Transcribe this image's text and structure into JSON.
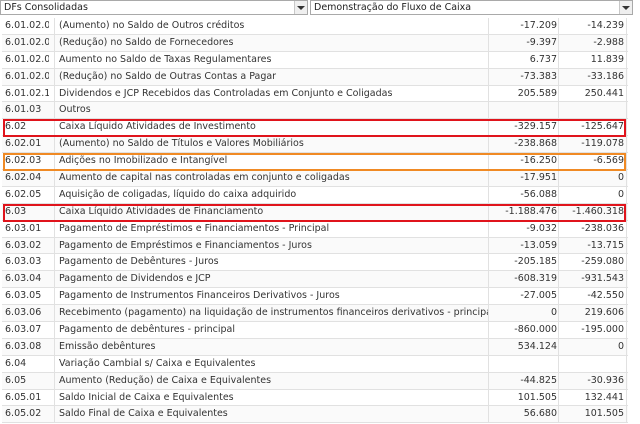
{
  "toolbar": {
    "dfs_select": "DFs Consolidadas",
    "statement_select": "Demonstração do Fluxo de Caixa"
  },
  "rows": [
    {
      "code": "6.01.02.06",
      "desc": "(Aumento) no Saldo de Outros créditos",
      "v1": "-17.209",
      "v2": "-14.239"
    },
    {
      "code": "6.01.02.07",
      "desc": "(Redução) no Saldo de Fornecedores",
      "v1": "-9.397",
      "v2": "-2.988"
    },
    {
      "code": "6.01.02.08",
      "desc": "Aumento no Saldo de Taxas Regulamentares",
      "v1": "6.737",
      "v2": "11.839"
    },
    {
      "code": "6.01.02.09",
      "desc": "(Redução) no Saldo de Outras Contas a Pagar",
      "v1": "-73.383",
      "v2": "-33.186"
    },
    {
      "code": "6.01.02.10",
      "desc": "Dividendos e JCP Recebidos das Controladas em Conjunto e Coligadas",
      "v1": "205.589",
      "v2": "250.441"
    },
    {
      "code": "6.01.03",
      "desc": "Outros",
      "v1": "",
      "v2": ""
    },
    {
      "code": "6.02",
      "desc": "Caixa Líquido Atividades de Investimento",
      "v1": "-329.157",
      "v2": "-125.647"
    },
    {
      "code": "6.02.01",
      "desc": "(Aumento) no Saldo de Títulos e Valores Mobiliários",
      "v1": "-238.868",
      "v2": "-119.078"
    },
    {
      "code": "6.02.03",
      "desc": "Adições no Imobilizado e Intangível",
      "v1": "-16.250",
      "v2": "-6.569"
    },
    {
      "code": "6.02.04",
      "desc": "Aumento de capital nas controladas em conjunto e coligadas",
      "v1": "-17.951",
      "v2": "0"
    },
    {
      "code": "6.02.05",
      "desc": "Aquisição de coligadas, líquido do caixa adquirido",
      "v1": "-56.088",
      "v2": "0"
    },
    {
      "code": "6.03",
      "desc": "Caixa Líquido Atividades de Financiamento",
      "v1": "-1.188.476",
      "v2": "-1.460.318"
    },
    {
      "code": "6.03.01",
      "desc": "Pagamento de Empréstimos e Financiamentos - Principal",
      "v1": "-9.032",
      "v2": "-238.036"
    },
    {
      "code": "6.03.02",
      "desc": "Pagamento de Empréstimos e Financiamentos - Juros",
      "v1": "-13.059",
      "v2": "-13.715"
    },
    {
      "code": "6.03.03",
      "desc": "Pagamento de Debêntures - Juros",
      "v1": "-205.185",
      "v2": "-259.080"
    },
    {
      "code": "6.03.04",
      "desc": "Pagamento de Dividendos e JCP",
      "v1": "-608.319",
      "v2": "-931.543"
    },
    {
      "code": "6.03.05",
      "desc": "Pagamento de Instrumentos Financeiros Derivativos - Juros",
      "v1": "-27.005",
      "v2": "-42.550"
    },
    {
      "code": "6.03.06",
      "desc": "Recebimento (pagamento) na liquidação de instrumentos financeiros derivativos - principal",
      "v1": "0",
      "v2": "219.606"
    },
    {
      "code": "6.03.07",
      "desc": "Pagamento de debêntures - principal",
      "v1": "-860.000",
      "v2": "-195.000"
    },
    {
      "code": "6.03.08",
      "desc": "Emissão debêntures",
      "v1": "534.124",
      "v2": "0"
    },
    {
      "code": "6.04",
      "desc": "Variação Cambial s/ Caixa e Equivalentes",
      "v1": "",
      "v2": ""
    },
    {
      "code": "6.05",
      "desc": "Aumento (Redução) de Caixa e Equivalentes",
      "v1": "-44.825",
      "v2": "-30.936"
    },
    {
      "code": "6.05.01",
      "desc": "Saldo Inicial de Caixa e Equivalentes",
      "v1": "101.505",
      "v2": "132.441"
    },
    {
      "code": "6.05.02",
      "desc": "Saldo Final de Caixa e Equivalentes",
      "v1": "56.680",
      "v2": "101.505"
    }
  ],
  "highlights": [
    {
      "row": 6,
      "color": "#e0141c"
    },
    {
      "row": 8,
      "color": "#f08a24"
    },
    {
      "row": 11,
      "color": "#e0141c"
    }
  ]
}
